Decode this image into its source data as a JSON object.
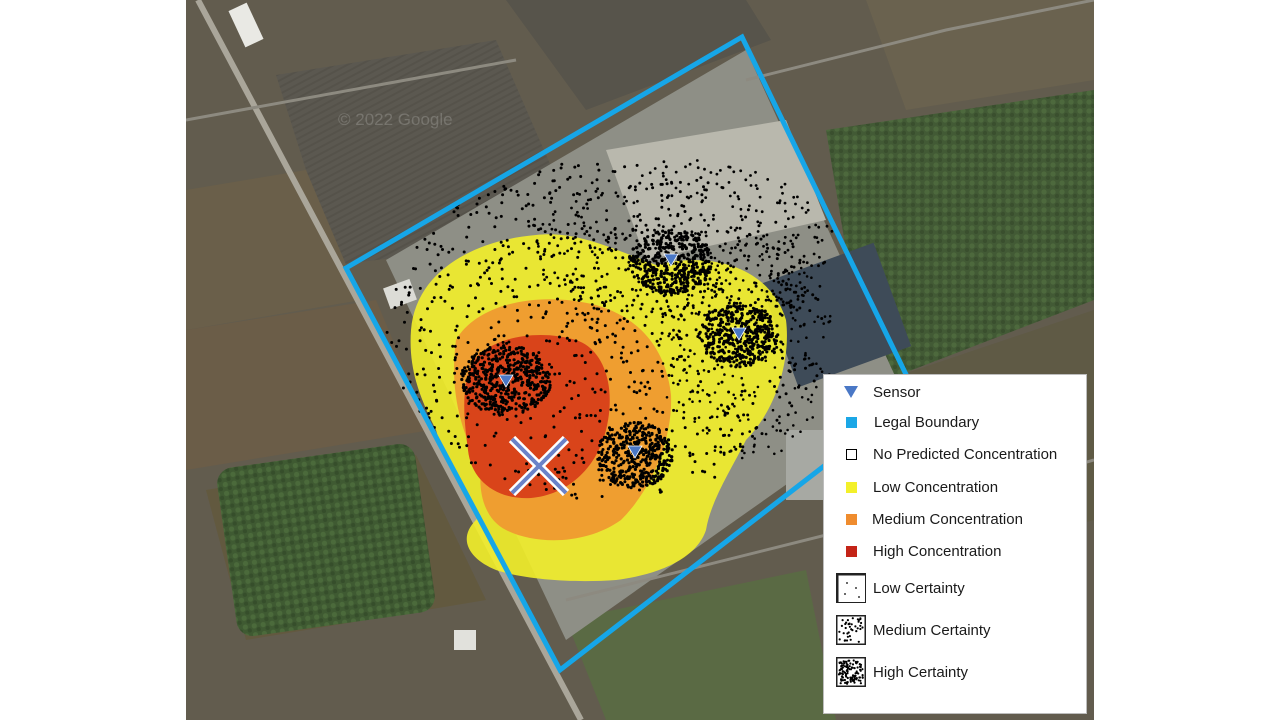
{
  "map": {
    "watermark": "© 2022 Google",
    "colors": {
      "boundary": "#16a6e8",
      "sensor": "#4a78c6",
      "low": "#f3f02a",
      "medium": "#ef9a30",
      "high": "#d9441a",
      "source_marker": "#6a82c8"
    },
    "sensors_count_shown": 4
  },
  "legend": {
    "items": [
      {
        "label": "Sensor",
        "symbol": "triangle-down-icon",
        "color": "#4a78c6"
      },
      {
        "label": "Legal Boundary",
        "symbol": "square-icon",
        "color": "#1ba7e6"
      },
      {
        "label": "No Predicted Concentration",
        "symbol": "outline-square-icon",
        "color": "#000000"
      },
      {
        "label": "Low Concentration",
        "symbol": "square-icon",
        "color": "#f3f02a"
      },
      {
        "label": "Medium Concentration",
        "symbol": "square-icon",
        "color": "#ef8c2e"
      },
      {
        "label": "High Concentration",
        "symbol": "square-icon",
        "color": "#c42417"
      },
      {
        "label": "Low Certainty",
        "symbol": "sparse-dots-icon"
      },
      {
        "label": "Medium Certainty",
        "symbol": "medium-dots-icon"
      },
      {
        "label": "High Certainty",
        "symbol": "dense-dots-icon"
      }
    ]
  }
}
